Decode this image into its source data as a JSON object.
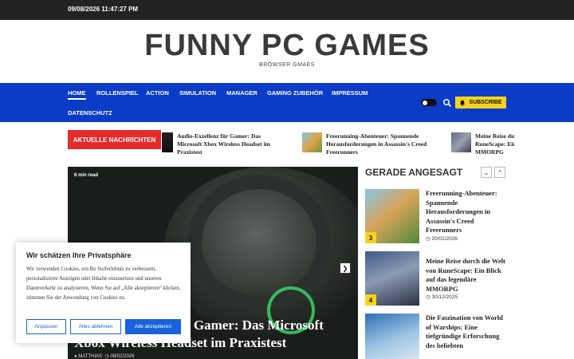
{
  "topbar": {
    "datetime": "09/08/2026 11:47:27 PM"
  },
  "header": {
    "title": "FUNNY PC GAMES",
    "tagline": "BROWSER GMAES"
  },
  "nav": {
    "items": [
      "HOME",
      "ROLLENSPIEL",
      "ACTION",
      "SIMULATION",
      "MANAGER",
      "GAMING ZUBEHÖR",
      "IMPRESSUM",
      "DATENSCHUTZ"
    ],
    "active": "HOME",
    "subscribe_label": "SUBSCRIBE"
  },
  "ticker": {
    "label": "AKTUELLE NACHRICHTEN",
    "items": [
      "Audio-Exzellenz für Gamer: Das Microsoft Xbox Wireless Headset im Praxistest",
      "Freerunning-Abenteuer: Spannende Herausforderungen in Assassin's Creed Freerunners",
      "Meine Reise durch die Welt von RuneScape: Ein Blick auf das legendäre MMORPG"
    ]
  },
  "hero": {
    "read_time": "6 min read",
    "title": "Audio-Exzellenz für Gamer: Das Microsoft Xbox Wireless Headset im Praxistest",
    "author": "MATTHIAS",
    "date": "08/02/2026"
  },
  "sidebar": {
    "title": "GERADE ANGESAGT",
    "posts": [
      {
        "num": "3",
        "title": "Freerunning-Abenteuer: Spannende Herausforderungen in Assassin's Creed Freerunners",
        "date": "20/01/2026"
      },
      {
        "num": "4",
        "title": "Meine Reise durch die Welt von RuneScape: Ein Blick auf das legendäre MMORPG",
        "date": "30/12/2025"
      },
      {
        "num": "5",
        "title": "Die Faszination von World of Warships: Eine tiefgründige Erforschung des beliebten",
        "date": ""
      }
    ]
  },
  "cookie": {
    "title": "Wir schätzen Ihre Privatsphäre",
    "body": "Wir verwenden Cookies, um Ihr Surferlebnis zu verbessern, personalisierte Anzeigen oder Inhalte einzusetzen und unseren Datenverkehr zu analysieren. Wenn Sie auf „Alle akzeptieren“ klicken, stimmen Sie der Anwendung von Cookies zu.",
    "customize": "Anpassen",
    "reject": "Alles ablehnen",
    "accept": "Alle akzeptieren"
  },
  "colors": {
    "nav_bg": "#0a3cc8",
    "accent": "#f7d21c",
    "ticker_label": "#e52a2a",
    "cookie_blue": "#1863dc",
    "topbar": "#222222"
  }
}
